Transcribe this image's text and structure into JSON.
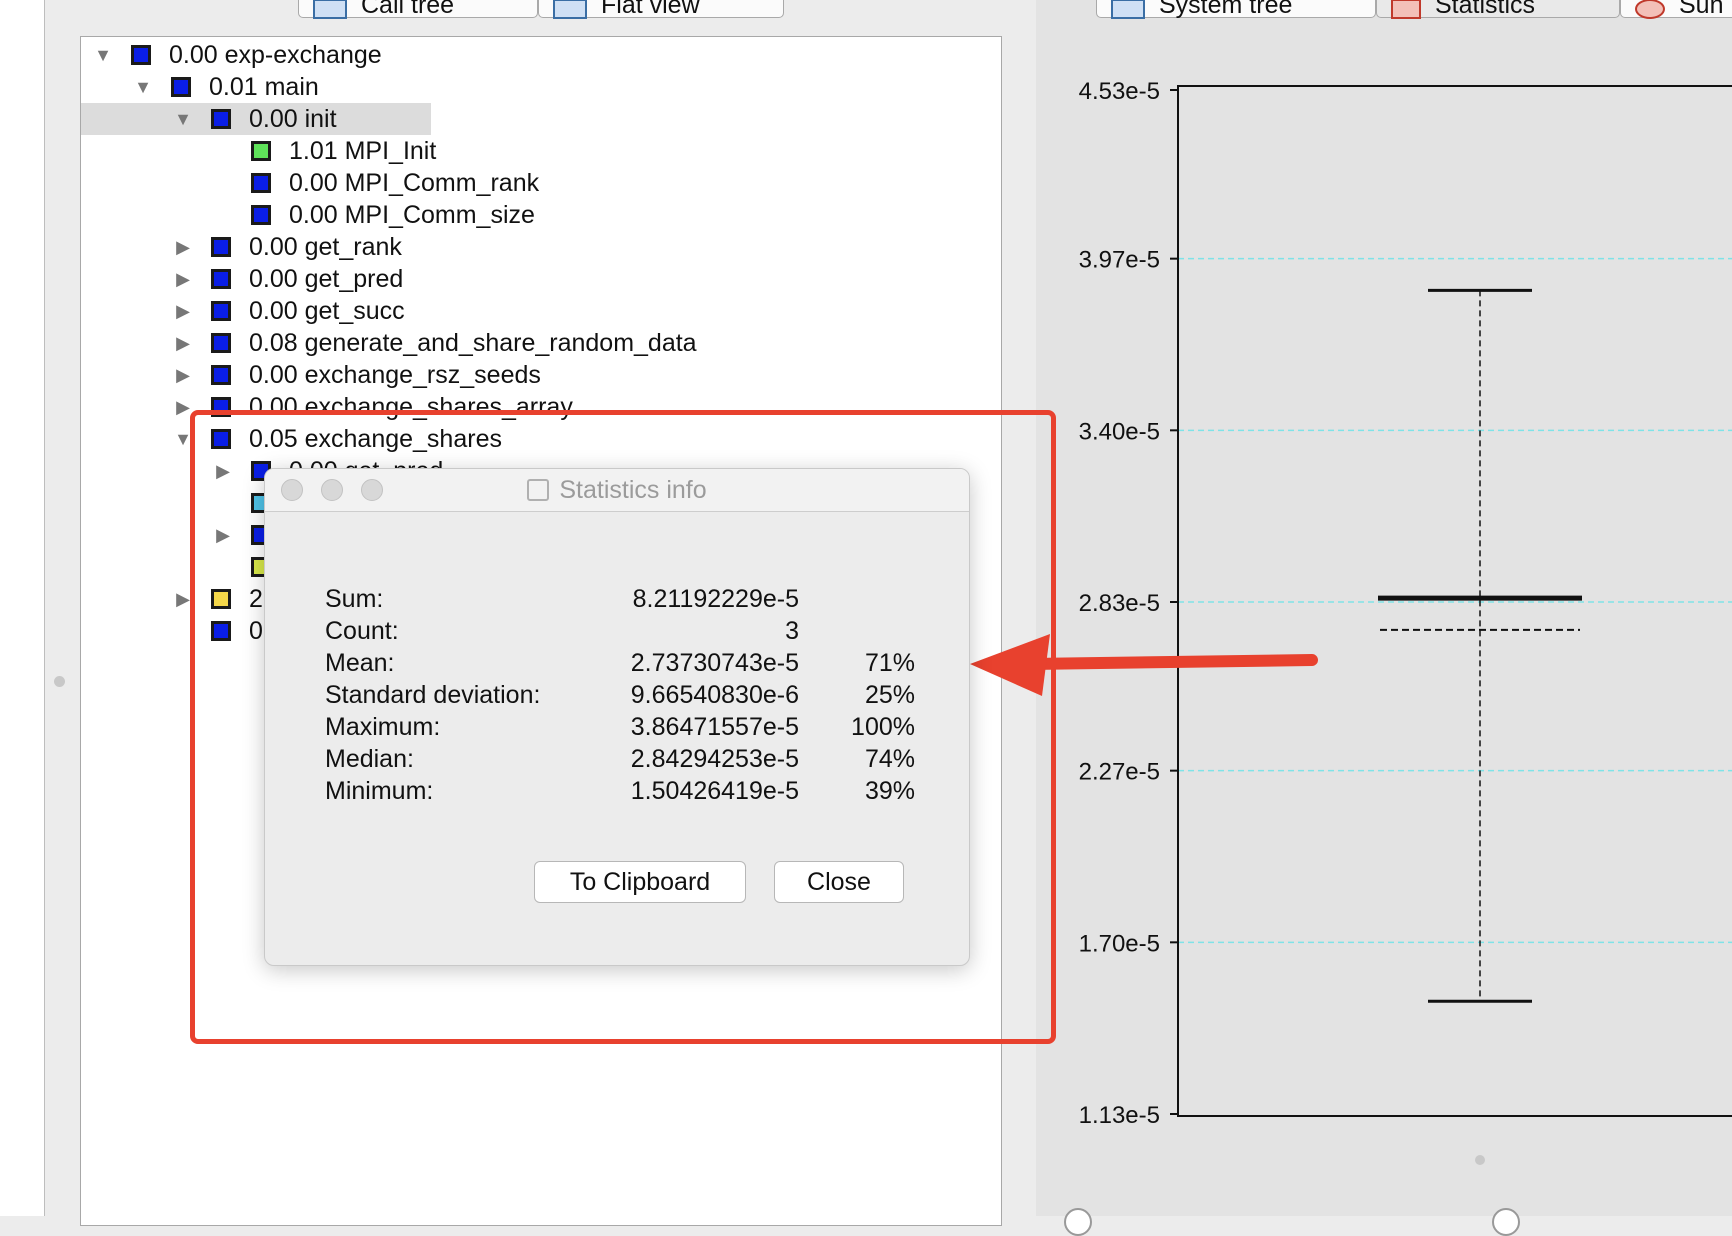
{
  "left_tabs": [
    {
      "label": "Call tree"
    },
    {
      "label": "Flat view"
    }
  ],
  "right_tabs": [
    {
      "label": "System tree"
    },
    {
      "label": "Statistics"
    },
    {
      "label": "Sun"
    }
  ],
  "call_tree": {
    "rows": [
      {
        "label": "0.00 exp-exchange",
        "level": 0,
        "expander": "down",
        "color": "#0a1ee6",
        "selected": false
      },
      {
        "label": "0.01 main",
        "level": 1,
        "expander": "down",
        "color": "#0a1ee6",
        "selected": false
      },
      {
        "label": "0.00 init",
        "level": 2,
        "expander": "down",
        "color": "#0a1ee6",
        "selected": true
      },
      {
        "label": "1.01 MPI_Init",
        "level": 3,
        "expander": "none",
        "color": "#5fe35a",
        "selected": false
      },
      {
        "label": "0.00 MPI_Comm_rank",
        "level": 3,
        "expander": "none",
        "color": "#0a1ee6",
        "selected": false
      },
      {
        "label": "0.00 MPI_Comm_size",
        "level": 3,
        "expander": "none",
        "color": "#0a1ee6",
        "selected": false
      },
      {
        "label": "0.00 get_rank",
        "level": 2,
        "expander": "right",
        "color": "#0a1ee6",
        "selected": false
      },
      {
        "label": "0.00 get_pred",
        "level": 2,
        "expander": "right",
        "color": "#0a1ee6",
        "selected": false
      },
      {
        "label": "0.00 get_succ",
        "level": 2,
        "expander": "right",
        "color": "#0a1ee6",
        "selected": false
      },
      {
        "label": "0.08 generate_and_share_random_data",
        "level": 2,
        "expander": "right",
        "color": "#0a1ee6",
        "selected": false
      },
      {
        "label": "0.00 exchange_rsz_seeds",
        "level": 2,
        "expander": "right",
        "color": "#0a1ee6",
        "selected": false
      },
      {
        "label": "0.00 exchange_shares_array",
        "level": 2,
        "expander": "right",
        "color": "#0a1ee6",
        "selected": false
      },
      {
        "label": "0.05 exchange_shares",
        "level": 2,
        "expander": "down",
        "color": "#0a1ee6",
        "selected": false
      },
      {
        "label": "0.00 get_pred",
        "level": 3,
        "expander": "right",
        "color": "#0a1ee6",
        "selected": false
      },
      {
        "label": "",
        "level": 3,
        "expander": "none",
        "color": "#4fc3e8",
        "selected": false
      },
      {
        "label": "",
        "level": 3,
        "expander": "right",
        "color": "#0a1ee6",
        "selected": false
      },
      {
        "label": "",
        "level": 3,
        "expander": "none",
        "color": "#d8e84a",
        "selected": false
      },
      {
        "label": "2.",
        "level": 2,
        "expander": "right",
        "color": "#f5d84a",
        "selected": false
      },
      {
        "label": "0.",
        "level": 2,
        "expander": "none",
        "color": "#0a1ee6",
        "selected": false
      }
    ]
  },
  "dialog": {
    "title": "Statistics info",
    "stats": [
      {
        "label": "Sum:",
        "value": "8.21192229e-5",
        "pct": ""
      },
      {
        "label": "Count:",
        "value": "3",
        "pct": ""
      },
      {
        "label": "Mean:",
        "value": "2.73730743e-5",
        "pct": "71%"
      },
      {
        "label": "Standard deviation:",
        "value": "9.66540830e-6",
        "pct": "25%"
      },
      {
        "label": "Maximum:",
        "value": "3.86471557e-5",
        "pct": "100%"
      },
      {
        "label": "Median:",
        "value": "2.84294253e-5",
        "pct": "74%"
      },
      {
        "label": "Minimum:",
        "value": "1.50426419e-5",
        "pct": "39%"
      }
    ],
    "clipboard_button": "To Clipboard",
    "close_button": "Close"
  },
  "annotation": {
    "color": "#e8412e"
  },
  "chart_data": {
    "type": "box",
    "y_ticks": [
      "4.53e-5",
      "3.97e-5",
      "3.40e-5",
      "2.83e-5",
      "2.27e-5",
      "1.70e-5",
      "1.13e-5"
    ],
    "ylim": [
      1.13e-05,
      4.53e-05
    ],
    "grid": true,
    "grid_color": "#7fe3e8",
    "box": {
      "max": 3.86471557e-05,
      "median": 2.84294253e-05,
      "mean": 2.73730743e-05,
      "min": 1.50426419e-05
    }
  },
  "radio_options": [
    "",
    ""
  ]
}
